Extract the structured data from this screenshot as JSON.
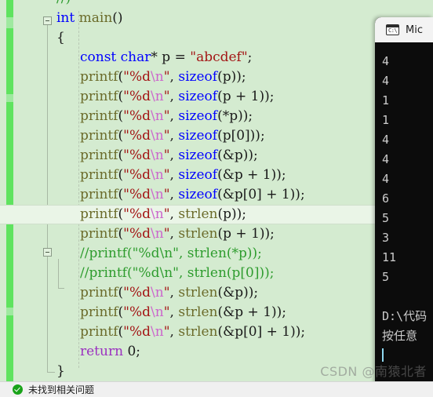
{
  "editor": {
    "current_line_index": 11,
    "lines": [
      {
        "indent": 0,
        "tokens": [
          {
            "t": "//)",
            "c": "cmt"
          }
        ],
        "clipped_top": true
      },
      {
        "indent": 0,
        "tokens": [
          {
            "t": "int ",
            "c": "kw"
          },
          {
            "t": "main",
            "c": "fn"
          },
          {
            "t": "()",
            "c": "plain"
          }
        ]
      },
      {
        "indent": 0,
        "tokens": [
          {
            "t": "{",
            "c": "plain"
          }
        ]
      },
      {
        "indent": 1,
        "tokens": [
          {
            "t": "const char",
            "c": "kw"
          },
          {
            "t": "* p = ",
            "c": "plain"
          },
          {
            "t": "\"abcdef\"",
            "c": "str"
          },
          {
            "t": ";",
            "c": "plain"
          }
        ]
      },
      {
        "indent": 1,
        "tokens": [
          {
            "t": "printf",
            "c": "fn"
          },
          {
            "t": "(",
            "c": "plain"
          },
          {
            "t": "\"%d",
            "c": "str"
          },
          {
            "t": "\\n",
            "c": "esc"
          },
          {
            "t": "\"",
            "c": "str"
          },
          {
            "t": ", ",
            "c": "plain"
          },
          {
            "t": "sizeof",
            "c": "kw"
          },
          {
            "t": "(p));",
            "c": "plain"
          }
        ]
      },
      {
        "indent": 1,
        "tokens": [
          {
            "t": "printf",
            "c": "fn"
          },
          {
            "t": "(",
            "c": "plain"
          },
          {
            "t": "\"%d",
            "c": "str"
          },
          {
            "t": "\\n",
            "c": "esc"
          },
          {
            "t": "\"",
            "c": "str"
          },
          {
            "t": ", ",
            "c": "plain"
          },
          {
            "t": "sizeof",
            "c": "kw"
          },
          {
            "t": "(p + 1));",
            "c": "plain"
          }
        ]
      },
      {
        "indent": 1,
        "tokens": [
          {
            "t": "printf",
            "c": "fn"
          },
          {
            "t": "(",
            "c": "plain"
          },
          {
            "t": "\"%d",
            "c": "str"
          },
          {
            "t": "\\n",
            "c": "esc"
          },
          {
            "t": "\"",
            "c": "str"
          },
          {
            "t": ", ",
            "c": "plain"
          },
          {
            "t": "sizeof",
            "c": "kw"
          },
          {
            "t": "(*p));",
            "c": "plain"
          }
        ]
      },
      {
        "indent": 1,
        "tokens": [
          {
            "t": "printf",
            "c": "fn"
          },
          {
            "t": "(",
            "c": "plain"
          },
          {
            "t": "\"%d",
            "c": "str"
          },
          {
            "t": "\\n",
            "c": "esc"
          },
          {
            "t": "\"",
            "c": "str"
          },
          {
            "t": ", ",
            "c": "plain"
          },
          {
            "t": "sizeof",
            "c": "kw"
          },
          {
            "t": "(p[0]));",
            "c": "plain"
          }
        ]
      },
      {
        "indent": 1,
        "tokens": [
          {
            "t": "printf",
            "c": "fn"
          },
          {
            "t": "(",
            "c": "plain"
          },
          {
            "t": "\"%d",
            "c": "str"
          },
          {
            "t": "\\n",
            "c": "esc"
          },
          {
            "t": "\"",
            "c": "str"
          },
          {
            "t": ", ",
            "c": "plain"
          },
          {
            "t": "sizeof",
            "c": "kw"
          },
          {
            "t": "(&p));",
            "c": "plain"
          }
        ]
      },
      {
        "indent": 1,
        "tokens": [
          {
            "t": "printf",
            "c": "fn"
          },
          {
            "t": "(",
            "c": "plain"
          },
          {
            "t": "\"%d",
            "c": "str"
          },
          {
            "t": "\\n",
            "c": "esc"
          },
          {
            "t": "\"",
            "c": "str"
          },
          {
            "t": ", ",
            "c": "plain"
          },
          {
            "t": "sizeof",
            "c": "kw"
          },
          {
            "t": "(&p + 1));",
            "c": "plain"
          }
        ]
      },
      {
        "indent": 1,
        "tokens": [
          {
            "t": "printf",
            "c": "fn"
          },
          {
            "t": "(",
            "c": "plain"
          },
          {
            "t": "\"%d",
            "c": "str"
          },
          {
            "t": "\\n",
            "c": "esc"
          },
          {
            "t": "\"",
            "c": "str"
          },
          {
            "t": ", ",
            "c": "plain"
          },
          {
            "t": "sizeof",
            "c": "kw"
          },
          {
            "t": "(&p[0] + 1));",
            "c": "plain"
          }
        ]
      },
      {
        "indent": 1,
        "tokens": [
          {
            "t": "printf",
            "c": "fn"
          },
          {
            "t": "(",
            "c": "plain"
          },
          {
            "t": "\"%d",
            "c": "str"
          },
          {
            "t": "\\n",
            "c": "esc"
          },
          {
            "t": "\"",
            "c": "str"
          },
          {
            "t": ", ",
            "c": "plain"
          },
          {
            "t": "strlen",
            "c": "fn"
          },
          {
            "t": "(p));",
            "c": "plain"
          }
        ]
      },
      {
        "indent": 1,
        "tokens": [
          {
            "t": "printf",
            "c": "fn"
          },
          {
            "t": "(",
            "c": "plain"
          },
          {
            "t": "\"%d",
            "c": "str"
          },
          {
            "t": "\\n",
            "c": "esc"
          },
          {
            "t": "\"",
            "c": "str"
          },
          {
            "t": ", ",
            "c": "plain"
          },
          {
            "t": "strlen",
            "c": "fn"
          },
          {
            "t": "(p + 1));",
            "c": "plain"
          }
        ]
      },
      {
        "indent": 1,
        "tokens": [
          {
            "t": "//printf(\"%d\\n\", strlen(*p));",
            "c": "cmt"
          }
        ]
      },
      {
        "indent": 1,
        "tokens": [
          {
            "t": "//printf(\"%d\\n\", strlen(p[0]));",
            "c": "cmt"
          }
        ]
      },
      {
        "indent": 1,
        "tokens": [
          {
            "t": "printf",
            "c": "fn"
          },
          {
            "t": "(",
            "c": "plain"
          },
          {
            "t": "\"%d",
            "c": "str"
          },
          {
            "t": "\\n",
            "c": "esc"
          },
          {
            "t": "\"",
            "c": "str"
          },
          {
            "t": ", ",
            "c": "plain"
          },
          {
            "t": "strlen",
            "c": "fn"
          },
          {
            "t": "(&p));",
            "c": "plain"
          }
        ]
      },
      {
        "indent": 1,
        "tokens": [
          {
            "t": "printf",
            "c": "fn"
          },
          {
            "t": "(",
            "c": "plain"
          },
          {
            "t": "\"%d",
            "c": "str"
          },
          {
            "t": "\\n",
            "c": "esc"
          },
          {
            "t": "\"",
            "c": "str"
          },
          {
            "t": ", ",
            "c": "plain"
          },
          {
            "t": "strlen",
            "c": "fn"
          },
          {
            "t": "(&p + 1));",
            "c": "plain"
          }
        ]
      },
      {
        "indent": 1,
        "tokens": [
          {
            "t": "printf",
            "c": "fn"
          },
          {
            "t": "(",
            "c": "plain"
          },
          {
            "t": "\"%d",
            "c": "str"
          },
          {
            "t": "\\n",
            "c": "esc"
          },
          {
            "t": "\"",
            "c": "str"
          },
          {
            "t": ", ",
            "c": "plain"
          },
          {
            "t": "strlen",
            "c": "fn"
          },
          {
            "t": "(&p[0] + 1));",
            "c": "plain"
          }
        ]
      },
      {
        "indent": 1,
        "tokens": [
          {
            "t": "return",
            "c": "ret"
          },
          {
            "t": " 0;",
            "c": "plain"
          }
        ]
      },
      {
        "indent": 0,
        "tokens": [
          {
            "t": "}",
            "c": "plain"
          }
        ]
      }
    ]
  },
  "statusbar": {
    "icon": "success-check-icon",
    "text": "未找到相关问题"
  },
  "console": {
    "icon": "command-prompt-icon",
    "icon_glyph": "C:\\",
    "title": "Mic",
    "output_lines": [
      "4",
      "4",
      "1",
      "1",
      "4",
      "4",
      "4",
      "6",
      "5",
      "3",
      "11",
      "5"
    ],
    "path_line": "D:\\代码",
    "prompt_line": "按任意",
    "caret_visible": true
  },
  "watermark": {
    "text": "CSDN @南猿北者"
  },
  "colors": {
    "editor_background": "#d4ebd0",
    "console_background": "#0c0c0c",
    "console_text": "#cccccc",
    "change_bar_saved": "#5fe35f",
    "keyword": "#0000ff",
    "string": "#a31515",
    "escape": "#cc66cc",
    "function": "#6b6b2a",
    "comment": "#2e9c2e",
    "return_keyword": "#9b30c0",
    "status_success": "#19a319",
    "current_line": "#eaf5e7"
  }
}
